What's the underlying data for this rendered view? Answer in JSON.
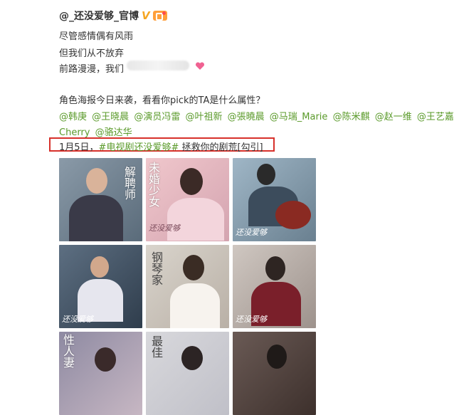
{
  "header": {
    "username": "@_还没爱够_官博",
    "verified_badge": "V",
    "level_icon": "level-badge-icon"
  },
  "post": {
    "lines": [
      "尽管感情偶有风雨",
      "但我们从不放弃",
      "前路漫漫，我们"
    ],
    "intro": "角色海报今日来袭，看看你pick的TA是什么属性？",
    "mentions_line1": [
      "@韩庚",
      "@王晓晨",
      "@演员冯雷",
      "@叶祖新",
      "@張曉晨",
      "@马瑞_Marie",
      "@陈米麒",
      "@赵一维",
      "@王艺嘉"
    ],
    "mentions_line2": [
      "Cherry",
      "@骆达华"
    ],
    "highlight": {
      "date": "1月5日，",
      "hashtag": "#电视剧还没爱够#",
      "rest": " 拯救你的剧荒[勾引]"
    }
  },
  "posters": [
    {
      "calligraphy": "解聘师",
      "logo": ""
    },
    {
      "calligraphy": "未婚少女",
      "logo": "还没爱够"
    },
    {
      "calligraphy": "",
      "logo": "还没爱够"
    },
    {
      "calligraphy": "",
      "logo": "还没爱够"
    },
    {
      "calligraphy": "钢琴家",
      "logo": ""
    },
    {
      "calligraphy": "",
      "logo": "还没爱够"
    },
    {
      "calligraphy": "性人妻",
      "logo": ""
    },
    {
      "calligraphy": "最佳",
      "logo": ""
    },
    {
      "calligraphy": "",
      "logo": ""
    }
  ],
  "colors": {
    "mention_green": "#5a9a2a",
    "highlight_red": "#d7312b",
    "verified_gold": "#f5a623"
  }
}
